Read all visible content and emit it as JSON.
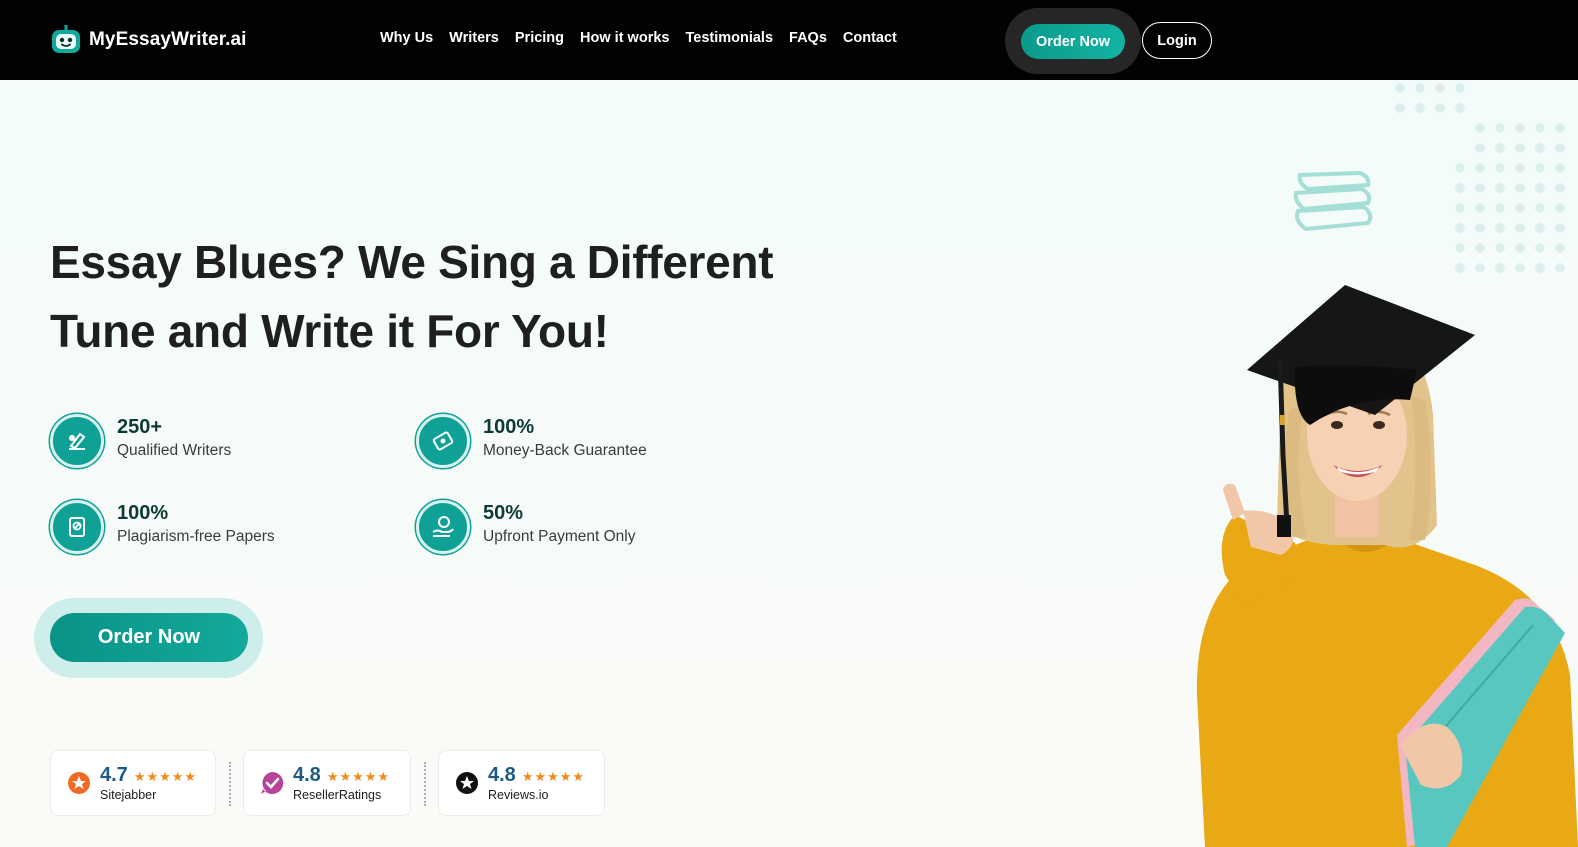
{
  "brand": {
    "name": "MyEssayWriter.ai"
  },
  "nav": {
    "items": [
      "Why Us",
      "Writers",
      "Pricing",
      "How it works",
      "Testimonials",
      "FAQs",
      "Contact"
    ]
  },
  "header_buttons": {
    "order": "Order Now",
    "login": "Login"
  },
  "hero": {
    "headline_line1": "Essay Blues? We Sing a Different",
    "headline_line2": "Tune and Write it For You!"
  },
  "features": [
    {
      "value": "250+",
      "label": "Qualified Writers",
      "icon": "writer-icon"
    },
    {
      "value": "100%",
      "label": "Money-Back Guarantee",
      "icon": "money-back-icon"
    },
    {
      "value": "100%",
      "label": "Plagiarism-free Papers",
      "icon": "plagiarism-free-icon"
    },
    {
      "value": "50%",
      "label": "Upfront Payment Only",
      "icon": "upfront-payment-icon"
    }
  ],
  "cta": {
    "label": "Order Now"
  },
  "ratings": [
    {
      "score": "4.7",
      "stars": "★★★★★",
      "name": "Sitejabber",
      "icon": "sitejabber-icon"
    },
    {
      "score": "4.8",
      "stars": "★★★★★",
      "name": "ResellerRatings",
      "icon": "resellerratings-icon"
    },
    {
      "score": "4.8",
      "stars": "★★★★★",
      "name": "Reviews.io",
      "icon": "reviewsio-icon"
    }
  ],
  "colors": {
    "accent": "#10a196",
    "header_bg": "#020202",
    "rating_score": "#1e5a86",
    "stars": "#f18a1c"
  }
}
